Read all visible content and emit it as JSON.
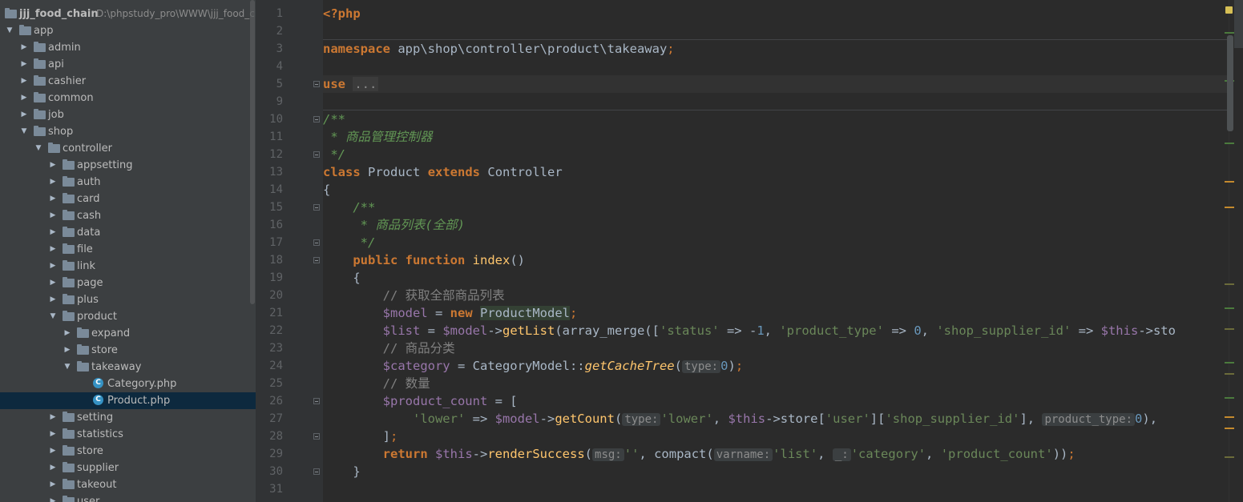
{
  "project": {
    "name": "jjj_food_chain",
    "path": "D:\\phpstudy_pro\\WWW\\jjj_food_chain"
  },
  "tree": [
    {
      "label": "app",
      "depth": 0,
      "kind": "folder",
      "open": true
    },
    {
      "label": "admin",
      "depth": 1,
      "kind": "folder",
      "open": false
    },
    {
      "label": "api",
      "depth": 1,
      "kind": "folder",
      "open": false
    },
    {
      "label": "cashier",
      "depth": 1,
      "kind": "folder",
      "open": false
    },
    {
      "label": "common",
      "depth": 1,
      "kind": "folder",
      "open": false
    },
    {
      "label": "job",
      "depth": 1,
      "kind": "folder",
      "open": false
    },
    {
      "label": "shop",
      "depth": 1,
      "kind": "folder",
      "open": true
    },
    {
      "label": "controller",
      "depth": 2,
      "kind": "folder",
      "open": true
    },
    {
      "label": "appsetting",
      "depth": 3,
      "kind": "folder",
      "open": false
    },
    {
      "label": "auth",
      "depth": 3,
      "kind": "folder",
      "open": false
    },
    {
      "label": "card",
      "depth": 3,
      "kind": "folder",
      "open": false
    },
    {
      "label": "cash",
      "depth": 3,
      "kind": "folder",
      "open": false
    },
    {
      "label": "data",
      "depth": 3,
      "kind": "folder",
      "open": false
    },
    {
      "label": "file",
      "depth": 3,
      "kind": "folder",
      "open": false
    },
    {
      "label": "link",
      "depth": 3,
      "kind": "folder",
      "open": false
    },
    {
      "label": "page",
      "depth": 3,
      "kind": "folder",
      "open": false
    },
    {
      "label": "plus",
      "depth": 3,
      "kind": "folder",
      "open": false
    },
    {
      "label": "product",
      "depth": 3,
      "kind": "folder",
      "open": true
    },
    {
      "label": "expand",
      "depth": 4,
      "kind": "folder",
      "open": false
    },
    {
      "label": "store",
      "depth": 4,
      "kind": "folder",
      "open": false
    },
    {
      "label": "takeaway",
      "depth": 4,
      "kind": "folder",
      "open": true
    },
    {
      "label": "Category.php",
      "depth": 5,
      "kind": "file"
    },
    {
      "label": "Product.php",
      "depth": 5,
      "kind": "file",
      "selected": true
    },
    {
      "label": "setting",
      "depth": 3,
      "kind": "folder",
      "open": false
    },
    {
      "label": "statistics",
      "depth": 3,
      "kind": "folder",
      "open": false
    },
    {
      "label": "store",
      "depth": 3,
      "kind": "folder",
      "open": false
    },
    {
      "label": "supplier",
      "depth": 3,
      "kind": "folder",
      "open": false
    },
    {
      "label": "takeout",
      "depth": 3,
      "kind": "folder",
      "open": false
    },
    {
      "label": "user",
      "depth": 3,
      "kind": "folder",
      "open": false
    }
  ],
  "editor": {
    "line_numbers": [
      "1",
      "2",
      "3",
      "4",
      "5",
      "9",
      "10",
      "11",
      "12",
      "13",
      "14",
      "15",
      "16",
      "17",
      "18",
      "19",
      "20",
      "21",
      "22",
      "23",
      "24",
      "25",
      "26",
      "27",
      "28",
      "29",
      "30",
      "31"
    ],
    "folded_text": "...",
    "comment_class_doc": " * 商品管理控制器",
    "comment_method_doc": " * 商品列表(全部)",
    "comment_get_all": "// 获取全部商品列表",
    "comment_category": "// 商品分类",
    "comment_count": "// 数量",
    "namespace_path": "app\\shop\\controller\\product\\takeaway",
    "class_name": "Product",
    "parent_class": "Controller",
    "method_name": "index",
    "model_class": "ProductModel",
    "hint_type": "type:",
    "hint_msg": "msg:",
    "hint_varname": "varname:",
    "hint_underscore": "_:",
    "hint_product_type": "product_type:"
  },
  "colors": {
    "keyword": "#cc7832",
    "string": "#6a8759",
    "number": "#6897bb",
    "variable": "#9876aa",
    "function": "#ffc66d",
    "doc_comment": "#629755",
    "line_comment": "#808080",
    "text": "#a9b7c6",
    "editor_bg": "#2b2b2b",
    "tree_bg": "#3c3f41",
    "selection": "#0d293e"
  }
}
